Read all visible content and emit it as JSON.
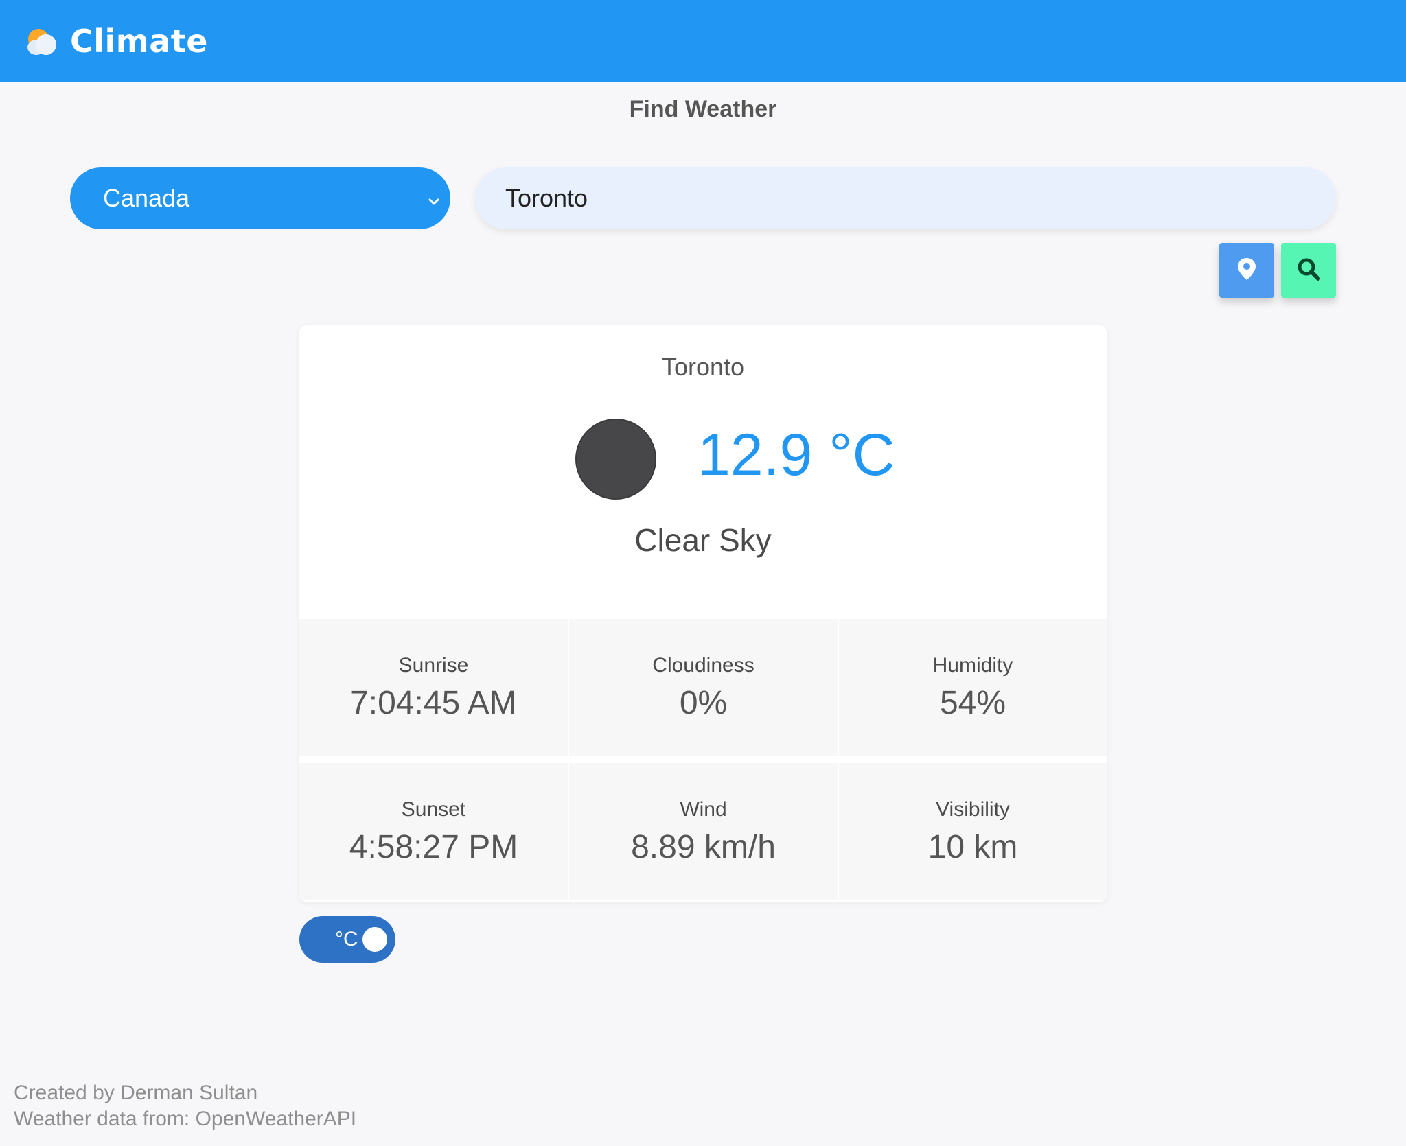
{
  "header": {
    "title": "Climate",
    "logo_icon": "sun-cloud-icon",
    "background_color": "#2196f3"
  },
  "search": {
    "heading": "Find Weather",
    "country_selected": "Canada",
    "city_value": "Toronto",
    "location_button_icon": "map-pin-icon",
    "search_button_icon": "search-icon",
    "location_button_color": "#4f9bf0",
    "search_button_color": "#57f5b3"
  },
  "weather": {
    "city": "Toronto",
    "temperature": "12.9 °C",
    "description": "Clear Sky",
    "icon": "clear-sky-night-icon",
    "stats": [
      {
        "label": "Sunrise",
        "value": "7:04:45 AM"
      },
      {
        "label": "Cloudiness",
        "value": "0%"
      },
      {
        "label": "Humidity",
        "value": "54%"
      },
      {
        "label": "Sunset",
        "value": "4:58:27 PM"
      },
      {
        "label": "Wind",
        "value": "8.89 km/h"
      },
      {
        "label": "Visibility",
        "value": "10 km"
      }
    ]
  },
  "unit_toggle": {
    "label": "°C",
    "color": "#2d72c4"
  },
  "footer": {
    "credit": "Created by Derman Sultan",
    "source": "Weather data from: OpenWeatherAPI"
  }
}
